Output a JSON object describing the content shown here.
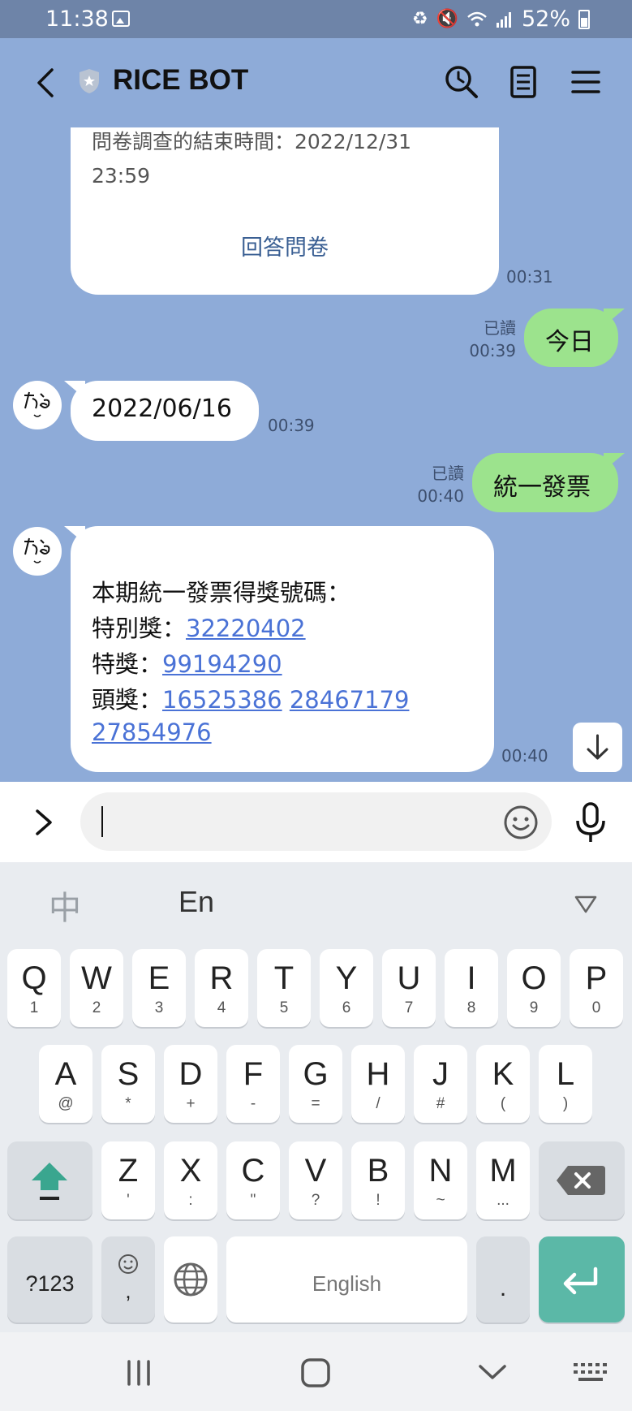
{
  "status_bar": {
    "time": "11:38",
    "battery": "52%"
  },
  "header": {
    "title": "RICE BOT"
  },
  "messages": {
    "survey": {
      "partial_line": "問卷調查的結束時間：2022/12/31",
      "end_time": "23:59",
      "link_label": "回答問卷",
      "time": "00:31"
    },
    "today": {
      "text": "今日",
      "read": "已讀",
      "time": "00:39"
    },
    "date_reply": {
      "text": "2022/06/16",
      "time": "00:39"
    },
    "invoice": {
      "text": "統一發票",
      "read": "已讀",
      "time": "00:40"
    },
    "invoice_reply": {
      "heading": "本期統一發票得獎號碼：",
      "special_prize_label": "特別獎：",
      "special_prize": "32220402",
      "grand_prize_label": "特獎：",
      "grand_prize": "99194290",
      "first_prize_label": "頭獎：",
      "first_prize_1": "16525386",
      "first_prize_2": "28467179",
      "first_prize_3": "27854976",
      "time": "00:40"
    }
  },
  "input": {
    "placeholder": ""
  },
  "keyboard": {
    "lang_zh": "中",
    "lang_en": "En",
    "row1": [
      {
        "k": "Q",
        "s": "1"
      },
      {
        "k": "W",
        "s": "2"
      },
      {
        "k": "E",
        "s": "3"
      },
      {
        "k": "R",
        "s": "4"
      },
      {
        "k": "T",
        "s": "5"
      },
      {
        "k": "Y",
        "s": "6"
      },
      {
        "k": "U",
        "s": "7"
      },
      {
        "k": "I",
        "s": "8"
      },
      {
        "k": "O",
        "s": "9"
      },
      {
        "k": "P",
        "s": "0"
      }
    ],
    "row2": [
      {
        "k": "A",
        "s": "@"
      },
      {
        "k": "S",
        "s": "*"
      },
      {
        "k": "D",
        "s": "+"
      },
      {
        "k": "F",
        "s": "-"
      },
      {
        "k": "G",
        "s": "="
      },
      {
        "k": "H",
        "s": "/"
      },
      {
        "k": "J",
        "s": "#"
      },
      {
        "k": "K",
        "s": "("
      },
      {
        "k": "L",
        "s": ")"
      }
    ],
    "row3": [
      {
        "k": "Z",
        "s": "'"
      },
      {
        "k": "X",
        "s": ":"
      },
      {
        "k": "C",
        "s": "\""
      },
      {
        "k": "V",
        "s": "?"
      },
      {
        "k": "B",
        "s": "!"
      },
      {
        "k": "N",
        "s": "~"
      },
      {
        "k": "M",
        "s": "..."
      }
    ],
    "symbols_label": "?123",
    "comma": ",",
    "space_label": "English",
    "period": "."
  },
  "colors": {
    "chat_background": "#8eabd8",
    "sent_bubble": "#9ce38d",
    "link": "#4a72d6",
    "enter_key": "#5bb8a7"
  }
}
